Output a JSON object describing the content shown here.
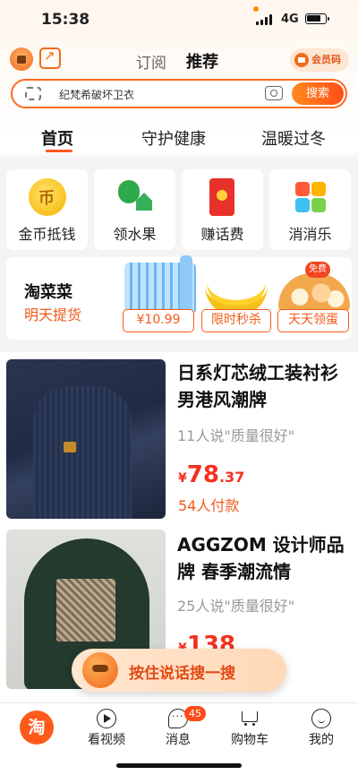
{
  "status": {
    "time": "15:38",
    "network": "4G"
  },
  "header": {
    "tabs": [
      "订阅",
      "推荐"
    ],
    "active_tab": "推荐",
    "member_label": "会员码"
  },
  "search": {
    "placeholder": "纪梵希破坏卫衣",
    "button": "搜索"
  },
  "categories": [
    "首页",
    "守护健康",
    "温暖过冬"
  ],
  "quick_tiles": [
    {
      "label": "金币抵钱",
      "icon": "gold-coin-icon"
    },
    {
      "label": "领水果",
      "icon": "fruit-tree-icon"
    },
    {
      "label": "赚话费",
      "icon": "red-envelope-icon"
    },
    {
      "label": "消消乐",
      "icon": "match-game-icon"
    }
  ],
  "taocaicai": {
    "title": "淘菜菜",
    "subtitle": "明天提货",
    "free_badge": "免费",
    "pills": [
      "¥10.99",
      "限时秒杀",
      "天天领蛋"
    ]
  },
  "feed": [
    {
      "title": "日系灯芯绒工装衬衫男港风潮牌",
      "review_preview": "11人说\"质量很好\"",
      "price_symbol": "¥",
      "price_int": "78",
      "price_dec": ".37",
      "paid": "54人付款"
    },
    {
      "title": "AGGZOM 设计师品牌 春季潮流情",
      "review_preview": "25人说\"质量很好\"",
      "price_symbol": "¥",
      "price_int": "138",
      "price_dec": ""
    }
  ],
  "voice_search": {
    "label": "按住说话搜一搜"
  },
  "tabbar": {
    "home_icon_text": "淘",
    "items": [
      "看视频",
      "消息",
      "购物车",
      "我的"
    ],
    "message_badge": "45"
  },
  "colors": {
    "accent": "#ff5a1a",
    "price": "#f2311e"
  }
}
